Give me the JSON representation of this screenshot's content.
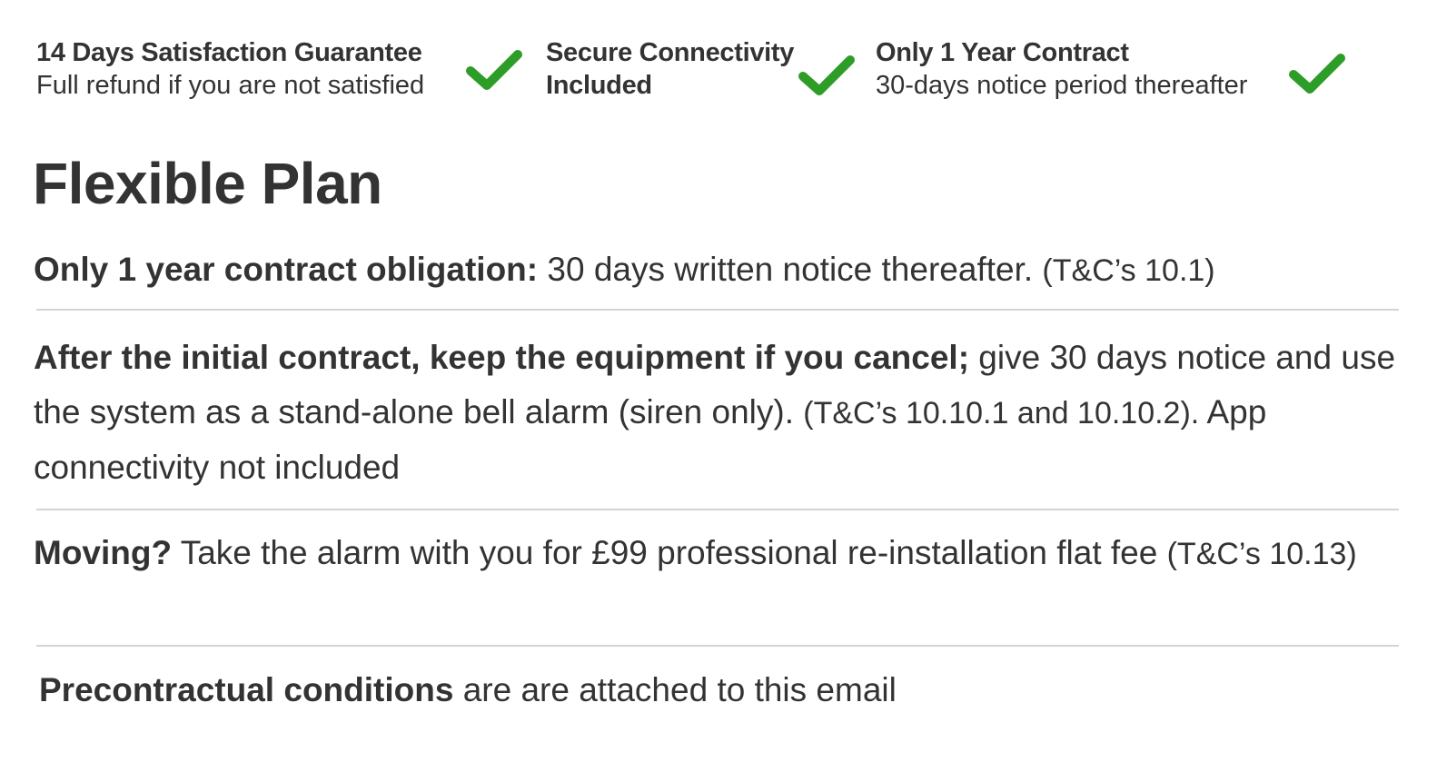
{
  "features": [
    {
      "title": "14 Days Satisfaction Guarantee",
      "subtitle": "Full refund if you are not satisfied",
      "icon": "check-icon"
    },
    {
      "title": "Secure Connectivity",
      "subtitle": "Included",
      "icon": "check-icon"
    },
    {
      "title": "Only 1 Year Contract",
      "subtitle": "30-days notice period thereafter",
      "icon": "check-icon"
    }
  ],
  "plan": {
    "title": "Flexible Plan",
    "items": [
      {
        "bold": "Only 1 year contract obligation:",
        "text": " 30 days written notice thereafter.",
        "ref": "(T&C’s 10.1)"
      },
      {
        "bold": "After the initial contract, keep the equipment if you cancel;",
        "text": " give 30 days notice and use the system as a stand-alone bell alarm (siren only).",
        "ref": "(T&C’s 10.10.1 and 10.10.2).",
        "tail": " App connectivity not included"
      },
      {
        "bold": "Moving?",
        "text": " Take the alarm with you for £99 professional re-installation flat fee",
        "ref": "(T&C’s 10.13)"
      },
      {
        "bold": "Precontractual conditions",
        "text": " are are attached to this email"
      }
    ]
  },
  "colors": {
    "check": "#2e9d27",
    "text": "#333333",
    "divider": "#d4d4d4"
  }
}
